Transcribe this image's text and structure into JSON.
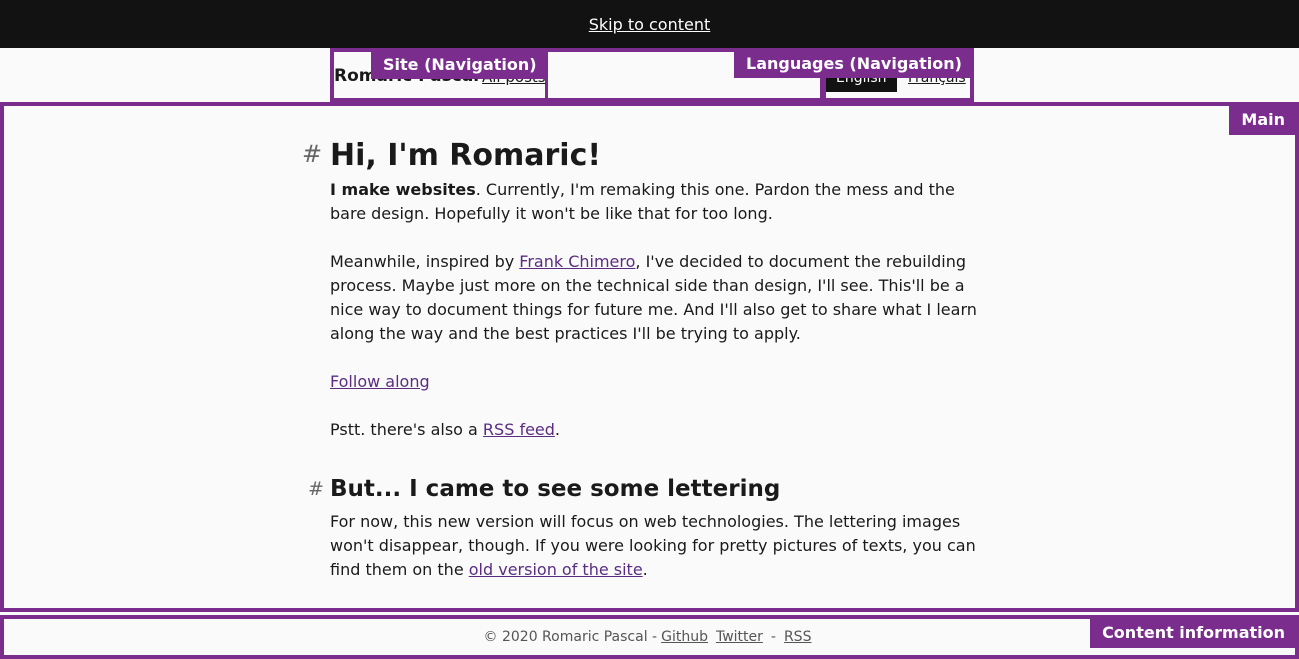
{
  "skip": {
    "label": "Skip to content"
  },
  "header": {
    "site_nav_tag": "Site (Navigation)",
    "brand": "Romaric Pascal",
    "all_posts": "All posts",
    "languages_tag": "Languages (Navigation)",
    "lang_en": "English",
    "lang_fr": "Français"
  },
  "main": {
    "tag": "Main",
    "h1": "Hi, I'm Romaric!",
    "h1_anchor": "#",
    "p1_strong": "I make websites",
    "p1_rest": ". Currently, I'm remaking this one. Pardon the mess and the bare design. Hopefully it won't be like that for too long.",
    "p2_before": "Meanwhile, inspired by ",
    "p2_link": "Frank Chimero",
    "p2_after": ", I've decided to document the rebuilding process. Maybe just more on the technical side than design, I'll see. This'll be a nice way to document things for future me. And I'll also get to share what I learn along the way and the best practices I'll be trying to apply.",
    "follow_link": "Follow along",
    "p4_before": "Pstt. there's also a ",
    "p4_link": "RSS feed",
    "p4_after": ".",
    "h2": "But... I came to see some lettering",
    "h2_anchor": "#",
    "p5_before": "For now, this new version will focus on web technologies. The lettering images won't disappear, though. If you were looking for pretty pictures of texts, you can find them on the ",
    "p5_link": "old version of the site",
    "p5_after": "."
  },
  "footer": {
    "tag": "Content information",
    "copyright": "© 2020 Romaric Pascal -",
    "github": "Github",
    "twitter": "Twitter",
    "sep": "-",
    "rss": "RSS"
  },
  "colors": {
    "accent": "#7b2d8e",
    "dark": "#121212",
    "link": "#5a2d82"
  }
}
